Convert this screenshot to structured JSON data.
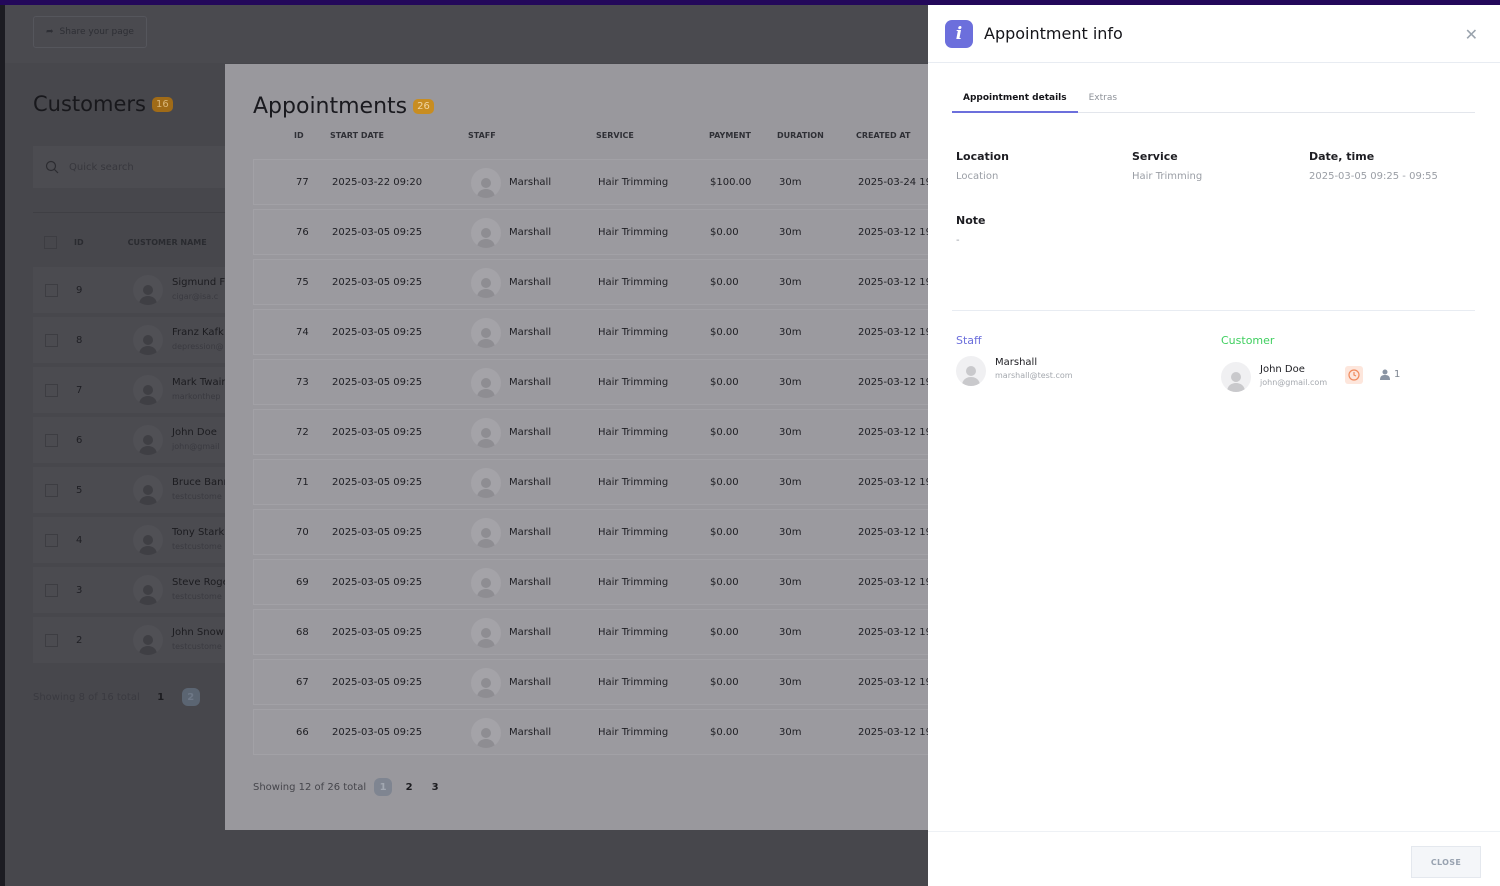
{
  "share_label": "Share your page",
  "customers": {
    "title": "Customers",
    "count": "16",
    "search_placeholder": "Quick search",
    "col_id": "ID",
    "col_name": "CUSTOMER NAME",
    "rows": [
      {
        "id": "9",
        "name": "Sigmund F",
        "email": "cigar@isa.c"
      },
      {
        "id": "8",
        "name": "Franz Kafk",
        "email": "depression@"
      },
      {
        "id": "7",
        "name": "Mark Twair",
        "email": "markonthep"
      },
      {
        "id": "6",
        "name": "John Doe",
        "email": "john@gmail"
      },
      {
        "id": "5",
        "name": "Bruce Banr",
        "email": "testcustome"
      },
      {
        "id": "4",
        "name": "Tony Stark",
        "email": "testcustome"
      },
      {
        "id": "3",
        "name": "Steve Roge",
        "email": "testcustome"
      },
      {
        "id": "2",
        "name": "John Snow",
        "email": "testcustome"
      }
    ],
    "pagination": {
      "summary": "Showing 8 of 16 total",
      "pages": [
        "1",
        "2"
      ],
      "active": "2"
    }
  },
  "appointments": {
    "title": "Appointments",
    "count": "26",
    "columns": [
      "ID",
      "START DATE",
      "STAFF",
      "SERVICE",
      "PAYMENT",
      "DURATION",
      "CREATED AT"
    ],
    "rows": [
      {
        "id": "77",
        "start": "2025-03-22 09:20",
        "staff": "Marshall",
        "service": "Hair Trimming",
        "payment": "$100.00",
        "duration": "30m",
        "created": "2025-03-24 19"
      },
      {
        "id": "76",
        "start": "2025-03-05 09:25",
        "staff": "Marshall",
        "service": "Hair Trimming",
        "payment": "$0.00",
        "duration": "30m",
        "created": "2025-03-12 19"
      },
      {
        "id": "75",
        "start": "2025-03-05 09:25",
        "staff": "Marshall",
        "service": "Hair Trimming",
        "payment": "$0.00",
        "duration": "30m",
        "created": "2025-03-12 19"
      },
      {
        "id": "74",
        "start": "2025-03-05 09:25",
        "staff": "Marshall",
        "service": "Hair Trimming",
        "payment": "$0.00",
        "duration": "30m",
        "created": "2025-03-12 19"
      },
      {
        "id": "73",
        "start": "2025-03-05 09:25",
        "staff": "Marshall",
        "service": "Hair Trimming",
        "payment": "$0.00",
        "duration": "30m",
        "created": "2025-03-12 19"
      },
      {
        "id": "72",
        "start": "2025-03-05 09:25",
        "staff": "Marshall",
        "service": "Hair Trimming",
        "payment": "$0.00",
        "duration": "30m",
        "created": "2025-03-12 19"
      },
      {
        "id": "71",
        "start": "2025-03-05 09:25",
        "staff": "Marshall",
        "service": "Hair Trimming",
        "payment": "$0.00",
        "duration": "30m",
        "created": "2025-03-12 19"
      },
      {
        "id": "70",
        "start": "2025-03-05 09:25",
        "staff": "Marshall",
        "service": "Hair Trimming",
        "payment": "$0.00",
        "duration": "30m",
        "created": "2025-03-12 19"
      },
      {
        "id": "69",
        "start": "2025-03-05 09:25",
        "staff": "Marshall",
        "service": "Hair Trimming",
        "payment": "$0.00",
        "duration": "30m",
        "created": "2025-03-12 19"
      },
      {
        "id": "68",
        "start": "2025-03-05 09:25",
        "staff": "Marshall",
        "service": "Hair Trimming",
        "payment": "$0.00",
        "duration": "30m",
        "created": "2025-03-12 19"
      },
      {
        "id": "67",
        "start": "2025-03-05 09:25",
        "staff": "Marshall",
        "service": "Hair Trimming",
        "payment": "$0.00",
        "duration": "30m",
        "created": "2025-03-12 19"
      },
      {
        "id": "66",
        "start": "2025-03-05 09:25",
        "staff": "Marshall",
        "service": "Hair Trimming",
        "payment": "$0.00",
        "duration": "30m",
        "created": "2025-03-12 19"
      }
    ],
    "pagination": {
      "summary": "Showing 12 of 26 total",
      "pages": [
        "1",
        "2",
        "3"
      ],
      "active": "1"
    }
  },
  "panel": {
    "title": "Appointment info",
    "tabs": [
      "Appointment details",
      "Extras"
    ],
    "location_label": "Location",
    "location_value": "Location",
    "service_label": "Service",
    "service_value": "Hair Trimming",
    "datetime_label": "Date, time",
    "datetime_value": "2025-03-05 09:25 - 09:55",
    "note_label": "Note",
    "note_value": "-",
    "staff_label": "Staff",
    "staff_name": "Marshall",
    "staff_email": "marshall@test.com",
    "customer_label": "Customer",
    "customer_name": "John Doe",
    "customer_email": "john@gmail.com",
    "people_count": "1",
    "close_label": "CLOSE",
    "colors": {
      "accent": "#6c6fdc",
      "staff": "#6c6fdc",
      "customer": "#3fcf5f",
      "clock": "#f08a5d"
    }
  }
}
